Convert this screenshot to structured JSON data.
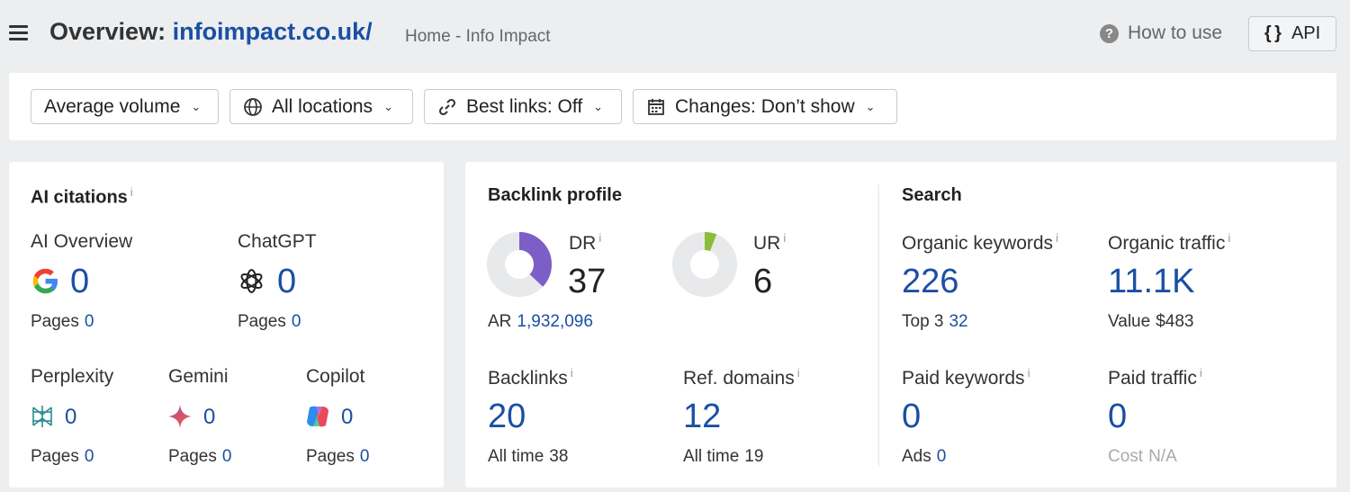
{
  "header": {
    "title_prefix": "Overview: ",
    "domain": "infoimpact.co.uk/",
    "page_title": "Home - Info Impact",
    "how_to_use": "How to use",
    "api_label": "API",
    "api_braces": "{ }"
  },
  "filters": {
    "volume": "Average volume",
    "locations": "All locations",
    "best_links": "Best links: Off",
    "changes": "Changes: Don’t show"
  },
  "ai_citations": {
    "title": "AI citations",
    "info": "i",
    "pages_label": "Pages",
    "sources": [
      {
        "name": "AI Overview",
        "value": "0",
        "pages": "0",
        "icon": "google-icon"
      },
      {
        "name": "ChatGPT",
        "value": "0",
        "pages": "0",
        "icon": "chatgpt-icon"
      },
      {
        "name": "Perplexity",
        "value": "0",
        "pages": "0",
        "icon": "perplexity-icon"
      },
      {
        "name": "Gemini",
        "value": "0",
        "pages": "0",
        "icon": "gemini-icon"
      },
      {
        "name": "Copilot",
        "value": "0",
        "pages": "0",
        "icon": "copilot-icon"
      }
    ]
  },
  "backlink_profile": {
    "title": "Backlink profile",
    "dr": {
      "label": "DR",
      "value": "37",
      "fraction": 0.37,
      "color": "#7b5fc7"
    },
    "ur": {
      "label": "UR",
      "value": "6",
      "fraction": 0.06,
      "color": "#8cbd3a"
    },
    "ar_label": "AR",
    "ar_value": "1,932,096",
    "backlinks": {
      "label": "Backlinks",
      "value": "20",
      "all_time_label": "All time",
      "all_time": "38"
    },
    "ref_domains": {
      "label": "Ref. domains",
      "value": "12",
      "all_time_label": "All time",
      "all_time": "19"
    }
  },
  "search": {
    "title": "Search",
    "organic_keywords": {
      "label": "Organic keywords",
      "value": "226",
      "sub_label": "Top 3",
      "sub_value": "32"
    },
    "organic_traffic": {
      "label": "Organic traffic",
      "value": "11.1K",
      "sub_label": "Value",
      "sub_value": "$483"
    },
    "paid_keywords": {
      "label": "Paid keywords",
      "value": "0",
      "sub_label": "Ads",
      "sub_value": "0"
    },
    "paid_traffic": {
      "label": "Paid traffic",
      "value": "0",
      "sub_label": "Cost",
      "sub_value": "N/A"
    }
  },
  "colors": {
    "link_blue": "#1a4fa3",
    "donut_track": "#e8e9eb"
  }
}
